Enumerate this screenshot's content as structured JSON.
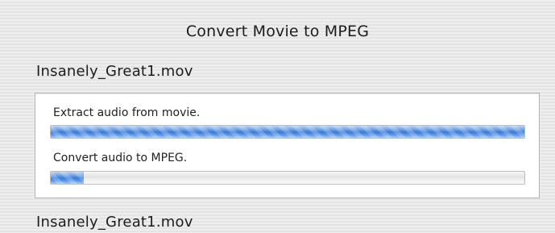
{
  "dialog": {
    "title": "Convert Movie to MPEG"
  },
  "files": [
    {
      "name": "Insanely_Great1.mov",
      "steps": [
        {
          "label": "Extract audio from movie.",
          "progress": 1.0
        },
        {
          "label": "Convert audio to MPEG.",
          "progress": 0.07
        }
      ]
    },
    {
      "name": "Insanely_Great1.mov"
    }
  ],
  "colors": {
    "progress_fill": "#3a7bd8",
    "panel_background": "#ffffff",
    "window_background": "#ececec"
  }
}
